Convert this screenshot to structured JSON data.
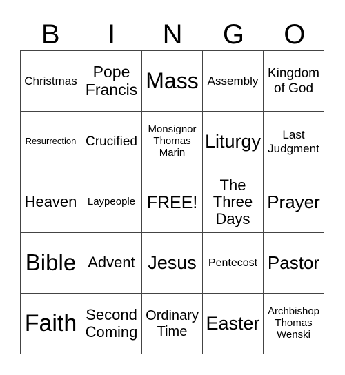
{
  "header": [
    "B",
    "I",
    "N",
    "G",
    "O"
  ],
  "cells": [
    {
      "text": "Christmas",
      "size": 17
    },
    {
      "text": "Pope Francis",
      "size": 23
    },
    {
      "text": "Mass",
      "size": 32
    },
    {
      "text": "Assembly",
      "size": 17
    },
    {
      "text": "Kingdom of God",
      "size": 19
    },
    {
      "text": "Resurrection",
      "size": 13
    },
    {
      "text": "Crucified",
      "size": 19
    },
    {
      "text": "Monsignor Thomas Marin",
      "size": 15
    },
    {
      "text": "Liturgy",
      "size": 27
    },
    {
      "text": "Last Judgment",
      "size": 17
    },
    {
      "text": "Heaven",
      "size": 22
    },
    {
      "text": "Laypeople",
      "size": 15
    },
    {
      "text": "FREE!",
      "size": 25
    },
    {
      "text": "The Three Days",
      "size": 22
    },
    {
      "text": "Prayer",
      "size": 26
    },
    {
      "text": "Bible",
      "size": 33
    },
    {
      "text": "Advent",
      "size": 22
    },
    {
      "text": "Jesus",
      "size": 27
    },
    {
      "text": "Pentecost",
      "size": 16
    },
    {
      "text": "Pastor",
      "size": 26
    },
    {
      "text": "Faith",
      "size": 34
    },
    {
      "text": "Second Coming",
      "size": 22
    },
    {
      "text": "Ordinary Time",
      "size": 20
    },
    {
      "text": "Easter",
      "size": 27
    },
    {
      "text": "Archbishop Thomas Wenski",
      "size": 15
    }
  ]
}
